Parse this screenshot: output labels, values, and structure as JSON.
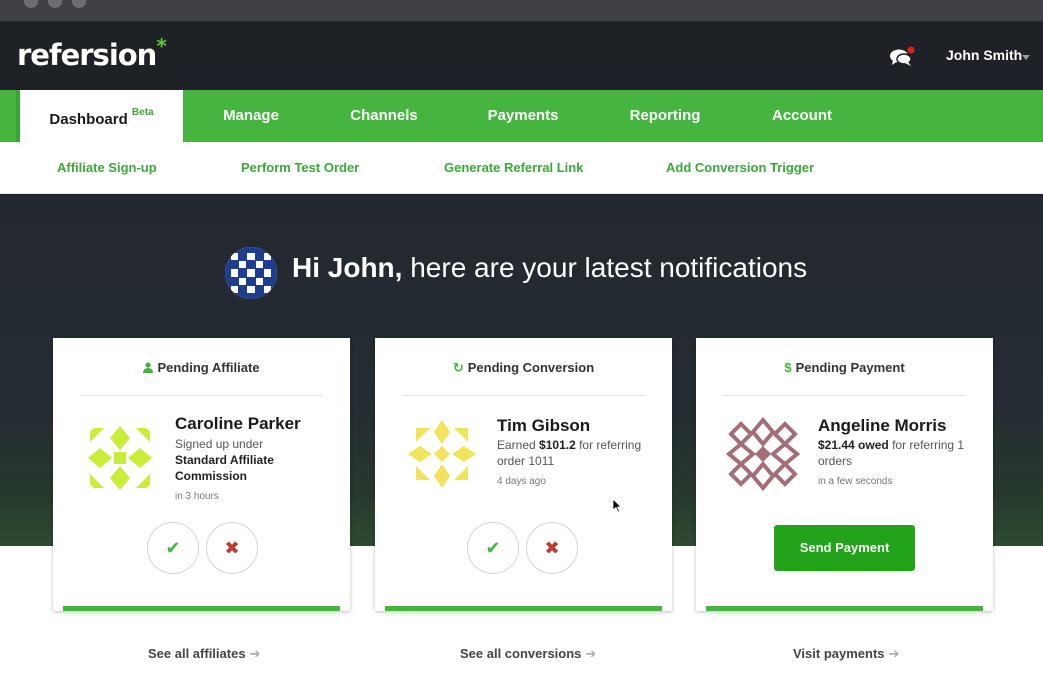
{
  "app": {
    "logo_text": "refersion",
    "logo_mark": "*"
  },
  "header": {
    "user_name": "John Smith",
    "chat_icon": "chat-bubbles-icon",
    "notification_color": "#e02020"
  },
  "main_nav": {
    "tabs": [
      {
        "label": "Dashboard",
        "badge": "Beta",
        "active": true
      },
      {
        "label": "Manage"
      },
      {
        "label": "Channels"
      },
      {
        "label": "Payments"
      },
      {
        "label": "Reporting"
      },
      {
        "label": "Account"
      }
    ]
  },
  "sub_nav": {
    "items": [
      "Affiliate Sign-up",
      "Perform Test Order",
      "Generate Referral Link",
      "Add Conversion Trigger"
    ]
  },
  "hero": {
    "greeting": "Hi John,",
    "message": "here are your latest notifications"
  },
  "cards": [
    {
      "title": "Pending Affiliate",
      "icon": "user-icon",
      "name": "Caroline Parker",
      "desc_plain": "Signed up under",
      "desc_bold": "Standard Affiliate Commission",
      "time": "in 3 hours",
      "link": "See all affiliates"
    },
    {
      "title": "Pending Conversion",
      "icon": "refresh-icon",
      "name": "Tim Gibson",
      "desc_prefix": "Earned",
      "desc_amount": "$101.2",
      "desc_suffix": "for referring order 1011",
      "time": "4 days ago",
      "link": "See all conversions"
    },
    {
      "title": "Pending Payment",
      "icon": "dollar-icon",
      "name": "Angeline Morris",
      "desc_amount": "$21.44 owed",
      "desc_suffix": "for referring 1 orders",
      "time": "in a few seconds",
      "button": "Send Payment",
      "link": "Visit payments"
    }
  ],
  "colors": {
    "brand_green": "#45b540",
    "dark_bg": "#1e2125",
    "reject_red": "#c0392b"
  }
}
